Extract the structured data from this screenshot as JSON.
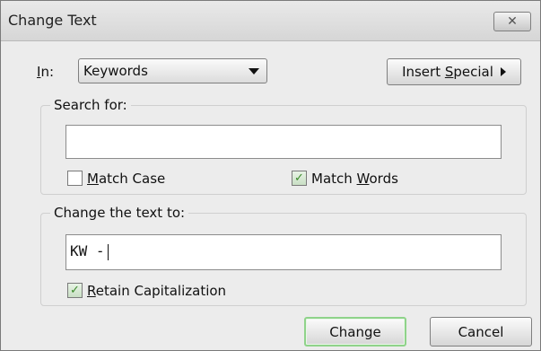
{
  "window": {
    "title": "Change Text",
    "close_icon": "✕"
  },
  "in_field": {
    "label_underlined": "I",
    "label_rest": "n:",
    "selected": "Keywords"
  },
  "insert_special": {
    "label_pre": "Insert ",
    "label_underlined": "S",
    "label_post": "pecial"
  },
  "search_group": {
    "title": "Search for:",
    "value": "",
    "match_case": {
      "underlined": "M",
      "rest": "atch Case",
      "checked": false
    },
    "match_words": {
      "pre": "Match ",
      "underlined": "W",
      "post": "ords",
      "checked": true
    }
  },
  "change_group": {
    "title": "Change the text to:",
    "value": "KW -",
    "retain_capitalization": {
      "underlined": "R",
      "rest": "etain Capitalization",
      "checked": true
    }
  },
  "buttons": {
    "change": "Change",
    "cancel": "Cancel"
  },
  "colors": {
    "default_button_border": "#8fd38a",
    "check_color": "#3a8a2a"
  }
}
